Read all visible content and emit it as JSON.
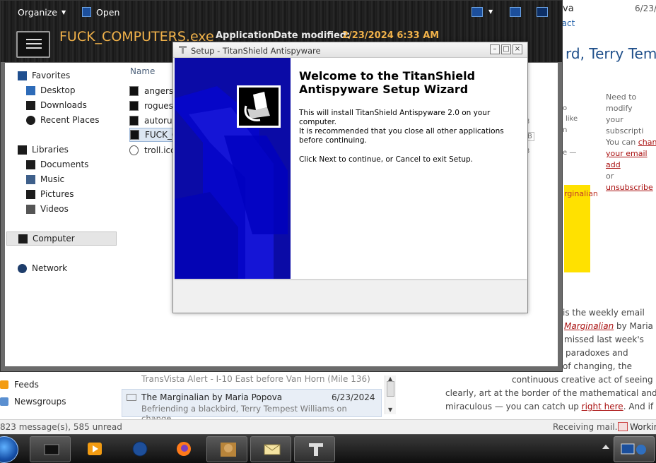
{
  "explorer": {
    "toolbar": {
      "organize": "Organize",
      "open": "Open"
    },
    "file": {
      "name": "FUCK_COMPUTERS.exe",
      "type": "Application",
      "modified_label": "Date modified:",
      "modified_value": "2/23/2024 6:33 AM"
    },
    "nav": {
      "favorites": "Favorites",
      "desktop": "Desktop",
      "downloads": "Downloads",
      "recent_places": "Recent Places",
      "libraries": "Libraries",
      "documents": "Documents",
      "music": "Music",
      "pictures": "Pictures",
      "videos": "Videos",
      "computer": "Computer",
      "network": "Network"
    },
    "column_name": "Name",
    "files": [
      "angersr",
      "rogues",
      "autorur",
      "FUCK_C",
      "troll.ico"
    ]
  },
  "setup": {
    "window_title": "Setup - TitanShield Antispyware",
    "heading": "Welcome to the TitanShield Antispyware Setup Wizard",
    "p1": "This will install TitanShield Antispyware 2.0 on your computer.",
    "p2": "It is recommended that you close all other applications before continuing.",
    "p3": "Click Next to continue, or Cancel to exit Setup."
  },
  "mail": {
    "folders": {
      "feeds": "Feeds",
      "newsgroups": "Newsgroups"
    },
    "messages": [
      {
        "from": "TransVista Alert - I-10 East before Van Horn (Mile 136)"
      },
      {
        "from": "The Marginalian by Maria Popova",
        "date": "6/23/2024",
        "preview": "Befriending a blackbird, Terry Tempest Williams on change..."
      }
    ],
    "reading": {
      "sender_frag": "va",
      "date_frag": "6/23/",
      "contact_frag": "tact",
      "subject_frag": "rd, Terry Tem",
      "side_note_1": "Need to modify",
      "side_note_2": "your subscripti",
      "side_note_3": "You can",
      "side_note_link1": "chan",
      "side_note_link2": "your email add",
      "side_note_4": "or",
      "side_note_link3": "unsubscribe",
      "frag_1": "o",
      "frag_2": "like",
      "frag_3": "n",
      "frag_4": "e —",
      "yellow_text": "rginalian",
      "body_1": "is the weekly email",
      "body_2a": "Marginalian",
      "body_2b": "by Maria",
      "body_3": "missed last week's",
      "body_4": "paradoxes and",
      "body_5": "of changing, the",
      "body_6": "continuous creative act of seeing",
      "body_7": "clearly, art at the border of the mathematical and the",
      "body_8a": "miraculous — you can catch up",
      "body_8b": "right here",
      "body_8c": ". And if my"
    },
    "status": {
      "count": "823 message(s), 585 unread",
      "receiving": "Receiving mail...",
      "working": "Working"
    }
  },
  "explorer_right_frags": [
    "3",
    "B",
    "3"
  ],
  "colors": {
    "wizard_blue": "#0a0a9e",
    "title_orange": "#f1b24a",
    "link_red": "#aa1111"
  }
}
